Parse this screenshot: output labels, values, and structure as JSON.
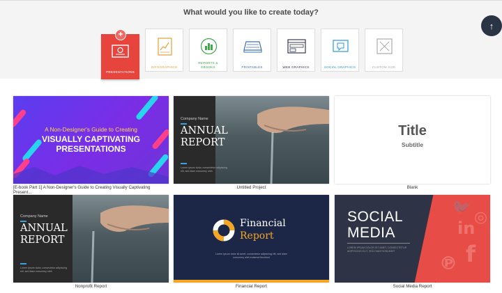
{
  "header": {
    "question": "What would you like to create today?",
    "scroll_up_icon": "arrow-up-icon"
  },
  "categories": [
    {
      "label": "PRESENTATIONS",
      "icon": "presentation-icon",
      "color": "#ffffff",
      "active": true
    },
    {
      "label": "INFOGRAPHICS",
      "icon": "infographic-icon",
      "color": "#e6a13a"
    },
    {
      "label": "REPORTS &",
      "label2": "EBOOKS",
      "icon": "report-icon",
      "color": "#3fa94b"
    },
    {
      "label": "PRINTABLES",
      "icon": "printable-icon",
      "color": "#3a6fb8"
    },
    {
      "label": "WEB GRAPHICS",
      "icon": "web-graphic-icon",
      "color": "#353a57"
    },
    {
      "label": "SOCIAL GRAPHICS",
      "icon": "social-graphic-icon",
      "color": "#2a9bd6"
    },
    {
      "label": "CUSTOM SIZE",
      "icon": "custom-size-icon",
      "color": "#aaaaaa"
    }
  ],
  "cards": [
    {
      "caption": "[E-book Part 1] A Non-Designer's Guide to Creating Visually Captivating Present...",
      "line1": "A Non-Designer's Guide to Creating",
      "line2": "VISUALLY CAPTIVATING",
      "line3": "PRESENTATIONS"
    },
    {
      "caption": "Untitled Project",
      "company": "Company Name",
      "title1": "ANNUAL",
      "title2": "REPORT",
      "small1": "Lorem ipsum dolor, consectetur adipiscing",
      "small2": "elit, sed diam nonummy nibh"
    },
    {
      "caption": "Blank",
      "title": "Title",
      "subtitle": "Subtitle"
    },
    {
      "caption": "Nonprofit Report",
      "company": "Company Name",
      "title1": "ANNUAL",
      "title2": "REPORT",
      "small1": "Lorem ipsum dolor, consectetur adipiscing",
      "small2": "elit, sed diam nonummy nibh"
    },
    {
      "caption": "Financial Report",
      "title1": "Financial",
      "title2": "Report",
      "small1": "Lorem ipsum dolor sit amet, consectetur adipiscing elit, sed diam",
      "small2": "nonummy nibh euismod tincidunt"
    },
    {
      "caption": "Social Media Report",
      "title1": "SOCIAL",
      "title2": "MEDIA",
      "small1": "LOREM IPSUM DOLOR SIT AMET, CONSECTETUR",
      "small2": "ADIPISCING ELIT, SED DIAM NONUMMY"
    }
  ],
  "colors": {
    "accent_red": "#e8443e",
    "navy": "#1c2747",
    "gold": "#f5a623",
    "blue": "#39a3dd"
  }
}
